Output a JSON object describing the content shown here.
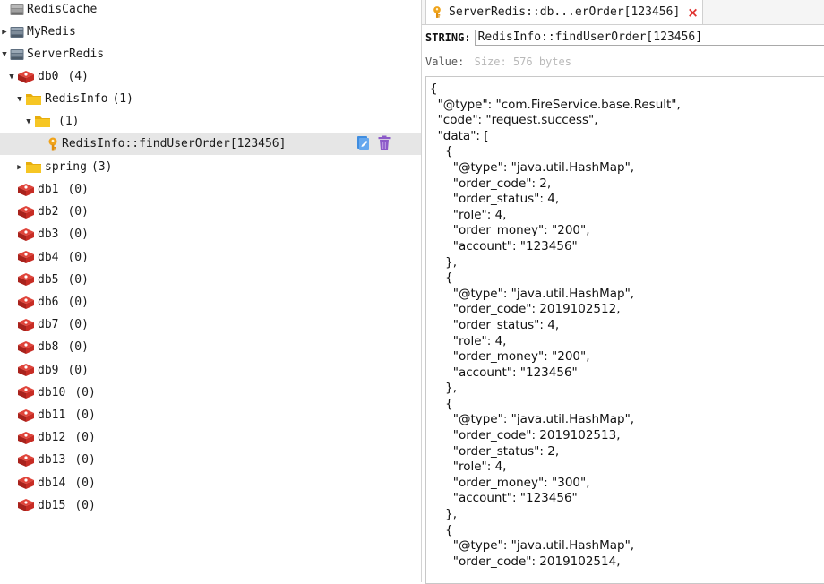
{
  "tree": {
    "connections": [
      {
        "label": "RedisCache"
      },
      {
        "label": "MyRedis"
      },
      {
        "label": "ServerRedis"
      }
    ],
    "db0": {
      "label": "db0",
      "count": "(4)"
    },
    "redisinfo": {
      "label": "RedisInfo",
      "count": "(1)"
    },
    "subfolder": {
      "label": "",
      "count": "(1)"
    },
    "selected_key": {
      "label": "RedisInfo::findUserOrder[123456]"
    },
    "spring": {
      "label": "spring",
      "count": "(3)"
    },
    "dbs": [
      {
        "label": "db1",
        "count": "(0)"
      },
      {
        "label": "db2",
        "count": "(0)"
      },
      {
        "label": "db3",
        "count": "(0)"
      },
      {
        "label": "db4",
        "count": "(0)"
      },
      {
        "label": "db5",
        "count": "(0)"
      },
      {
        "label": "db6",
        "count": "(0)"
      },
      {
        "label": "db7",
        "count": "(0)"
      },
      {
        "label": "db8",
        "count": "(0)"
      },
      {
        "label": "db9",
        "count": "(0)"
      },
      {
        "label": "db10",
        "count": "(0)"
      },
      {
        "label": "db11",
        "count": "(0)"
      },
      {
        "label": "db12",
        "count": "(0)"
      },
      {
        "label": "db13",
        "count": "(0)"
      },
      {
        "label": "db14",
        "count": "(0)"
      },
      {
        "label": "db15",
        "count": "(0)"
      }
    ]
  },
  "icons": {
    "connection": "server-icon",
    "database": "redis-db-icon",
    "folder": "folder-icon",
    "key": "key-icon",
    "copy": "copy-icon",
    "delete": "trash-icon",
    "close": "close-icon"
  },
  "colors": {
    "redis_red": "#d9302a",
    "folder_yellow": "#f5c01a",
    "key_orange": "#f0a31a",
    "copy_blue": "#3f8de0",
    "trash_purple": "#8c5ac8",
    "close_red": "#e0322f",
    "selected_row": "#e6e6e6"
  },
  "tab": {
    "label": "ServerRedis::db...erOrder[123456]",
    "close": "×"
  },
  "viewer": {
    "type_label": "STRING:",
    "key_value": "RedisInfo::findUserOrder[123456]",
    "value_label": "Value:",
    "size_label": "Size: 576 bytes",
    "json_text": "{\n  \"@type\": \"com.FireService.base.Result\",\n  \"code\": \"request.success\",\n  \"data\": [\n    {\n      \"@type\": \"java.util.HashMap\",\n      \"order_code\": 2,\n      \"order_status\": 4,\n      \"role\": 4,\n      \"order_money\": \"200\",\n      \"account\": \"123456\"\n    },\n    {\n      \"@type\": \"java.util.HashMap\",\n      \"order_code\": 2019102512,\n      \"order_status\": 4,\n      \"role\": 4,\n      \"order_money\": \"200\",\n      \"account\": \"123456\"\n    },\n    {\n      \"@type\": \"java.util.HashMap\",\n      \"order_code\": 2019102513,\n      \"order_status\": 2,\n      \"role\": 4,\n      \"order_money\": \"300\",\n      \"account\": \"123456\"\n    },\n    {\n      \"@type\": \"java.util.HashMap\",\n      \"order_code\": 2019102514,"
  }
}
